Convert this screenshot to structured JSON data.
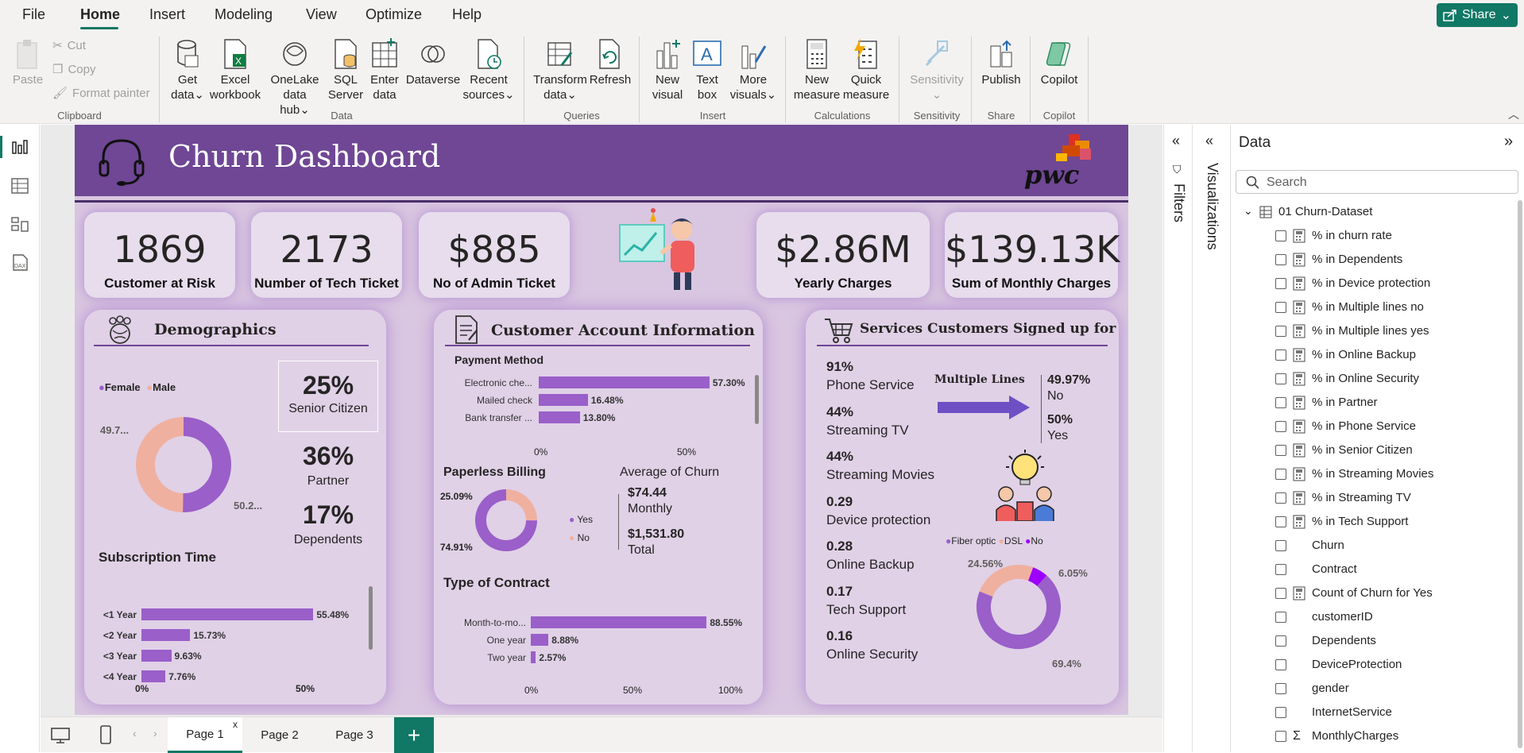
{
  "menu": {
    "items": [
      "File",
      "Home",
      "Insert",
      "Modeling",
      "View",
      "Optimize",
      "Help"
    ],
    "share": "Share"
  },
  "ribbon": {
    "clipboard": {
      "paste": "Paste",
      "cut": "Cut",
      "copy": "Copy",
      "format_painter": "Format painter",
      "group": "Clipboard"
    },
    "data": {
      "get_data": "Get",
      "get_data2": "data",
      "excel": "Excel",
      "excel2": "workbook",
      "onelake": "OneLake",
      "onelake2": "data hub",
      "sql": "SQL",
      "sql2": "Server",
      "enter": "Enter",
      "enter2": "data",
      "dataverse": "Dataverse",
      "recent": "Recent",
      "recent2": "sources",
      "group": "Data"
    },
    "queries": {
      "transform": "Transform",
      "transform2": "data",
      "refresh": "Refresh",
      "group": "Queries"
    },
    "insert": {
      "new_visual": "New",
      "new_visual2": "visual",
      "text_box": "Text",
      "text_box2": "box",
      "more_visuals": "More",
      "more_visuals2": "visuals",
      "group": "Insert"
    },
    "calculations": {
      "new_measure": "New",
      "new_measure2": "measure",
      "quick_measure": "Quick",
      "quick_measure2": "measure",
      "group": "Calculations"
    },
    "sensitivity": {
      "label": "Sensitivity",
      "group": "Sensitivity"
    },
    "share": {
      "publish": "Publish",
      "group": "Share"
    },
    "copilot": {
      "label": "Copilot",
      "group": "Copilot"
    }
  },
  "report": {
    "title": "Churn Dashboard",
    "logo": "pwc",
    "kpis": [
      {
        "value": "1869",
        "label": "Customer at Risk"
      },
      {
        "value": "2173",
        "label": "Number of Tech Ticket"
      },
      {
        "value": "$885",
        "label": "No of Admin Ticket"
      },
      {
        "value": "$2.86M",
        "label": "Yearly Charges"
      },
      {
        "value": "$139.13K",
        "label": "Sum of Monthly Charges"
      }
    ],
    "demographics": {
      "title": "Demographics",
      "legend": [
        "Female",
        "Male"
      ],
      "female_label": "50.2...",
      "male_label": "49.7...",
      "female_pct": 50.2,
      "male_pct": 49.7,
      "senior_value": "25%",
      "senior_label": "Senior Citizen",
      "partner_value": "36%",
      "partner_label": "Partner",
      "dependents_value": "17%",
      "dependents_label": "Dependents",
      "subscription_title": "Subscription Time",
      "subscription": [
        {
          "label": "<1 Year",
          "value": 55.48,
          "text": "55.48%"
        },
        {
          "label": "<2 Year",
          "value": 15.73,
          "text": "15.73%"
        },
        {
          "label": "<3 Year",
          "value": 9.63,
          "text": "9.63%"
        },
        {
          "label": "<4 Year",
          "value": 7.76,
          "text": "7.76%"
        }
      ],
      "axis": [
        "0%",
        "50%"
      ]
    },
    "account": {
      "title": "Customer Account Information",
      "payment_title": "Payment Method",
      "payment": [
        {
          "label": "Electronic che...",
          "value": 57.3,
          "text": "57.30%"
        },
        {
          "label": "Mailed check",
          "value": 16.48,
          "text": "16.48%"
        },
        {
          "label": "Bank transfer ...",
          "value": 13.8,
          "text": "13.80%"
        }
      ],
      "payment_axis": [
        "0%",
        "50%"
      ],
      "paperless_title": "Paperless Billing",
      "paperless_yes_label": "74.91%",
      "paperless_no_label": "25.09%",
      "paperless_yes": 74.91,
      "paperless_no": 25.09,
      "paperless_legend": [
        "Yes",
        "No"
      ],
      "avg_title": "Average of Churn",
      "avg_monthly_value": "$74.44",
      "avg_monthly_label": "Monthly",
      "avg_total_value": "$1,531.80",
      "avg_total_label": "Total",
      "contract_title": "Type of Contract",
      "contract": [
        {
          "label": "Month-to-mo...",
          "value": 88.55,
          "text": "88.55%"
        },
        {
          "label": "One year",
          "value": 8.88,
          "text": "8.88%"
        },
        {
          "label": "Two year",
          "value": 2.57,
          "text": "2.57%"
        }
      ],
      "contract_axis": [
        "0%",
        "50%",
        "100%"
      ]
    },
    "services": {
      "title": "Services Customers Signed up for",
      "items": [
        {
          "value": "91%",
          "label": "Phone Service"
        },
        {
          "value": "44%",
          "label": "Streaming TV"
        },
        {
          "value": "44%",
          "label": "Streaming Movies"
        },
        {
          "value": "0.29",
          "label": "Device protection"
        },
        {
          "value": "0.28",
          "label": "Online Backup"
        },
        {
          "value": "0.17",
          "label": "Tech Support"
        },
        {
          "value": "0.16",
          "label": "Online Security"
        }
      ],
      "multiple_lines_title": "Multiple Lines",
      "ml_no_value": "49.97%",
      "ml_no_label": "No",
      "ml_yes_value": "50%",
      "ml_yes_label": "Yes",
      "internet_legend": [
        "Fiber optic",
        "DSL",
        "No"
      ],
      "internet_labels": [
        "69.4%",
        "24.56%",
        "6.05%"
      ],
      "internet_values": [
        69.4,
        24.56,
        6.05
      ]
    }
  },
  "panes": {
    "filters": "Filters",
    "visualizations": "Visualizations",
    "data_title": "Data",
    "search_placeholder": "Search",
    "table": "01 Churn-Dataset",
    "fields": [
      {
        "name": "% in churn rate",
        "type": "measure"
      },
      {
        "name": "% in Dependents",
        "type": "measure"
      },
      {
        "name": "% in Device protection",
        "type": "measure"
      },
      {
        "name": "% in Multiple lines no",
        "type": "measure"
      },
      {
        "name": "% in Multiple lines yes",
        "type": "measure"
      },
      {
        "name": "% in Online Backup",
        "type": "measure"
      },
      {
        "name": "% in Online Security",
        "type": "measure"
      },
      {
        "name": "% in Partner",
        "type": "measure"
      },
      {
        "name": "% in Phone Service",
        "type": "measure"
      },
      {
        "name": "% in Senior Citizen",
        "type": "measure"
      },
      {
        "name": "% in Streaming Movies",
        "type": "measure"
      },
      {
        "name": "% in Streaming TV",
        "type": "measure"
      },
      {
        "name": "% in Tech Support",
        "type": "measure"
      },
      {
        "name": "Churn",
        "type": "column"
      },
      {
        "name": "Contract",
        "type": "column"
      },
      {
        "name": "Count of Churn for Yes",
        "type": "measure"
      },
      {
        "name": "customerID",
        "type": "column"
      },
      {
        "name": "Dependents",
        "type": "column"
      },
      {
        "name": "DeviceProtection",
        "type": "column"
      },
      {
        "name": "gender",
        "type": "column"
      },
      {
        "name": "InternetService",
        "type": "column"
      },
      {
        "name": "MonthlyCharges",
        "type": "sum"
      }
    ]
  },
  "pages": [
    "Page 1",
    "Page 2",
    "Page 3"
  ],
  "colors": {
    "accent": "#117865",
    "purple": "#6f4795",
    "bar": "#9a5fc9",
    "salmon": "#f0b0a0",
    "violet": "#9d00ff"
  }
}
